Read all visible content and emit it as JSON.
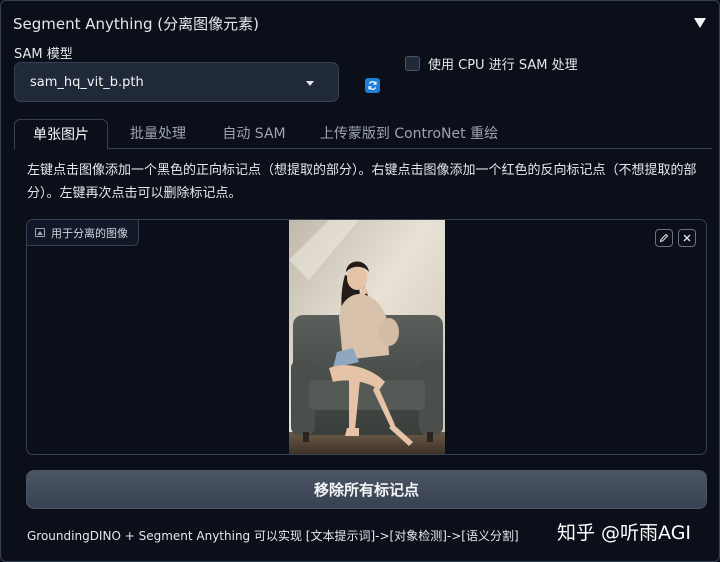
{
  "panel": {
    "title": "Segment Anything (分离图像元素)"
  },
  "model": {
    "label": "SAM 模型",
    "selected": "sam_hq_vit_b.pth"
  },
  "cpu_option": {
    "label": "使用 CPU 进行 SAM 处理",
    "checked": false
  },
  "tabs": [
    {
      "label": "单张图片",
      "active": true
    },
    {
      "label": "批量处理",
      "active": false
    },
    {
      "label": "自动 SAM",
      "active": false
    },
    {
      "label": "上传蒙版到 ControNet 重绘",
      "active": false
    }
  ],
  "instructions": "左键点击图像添加一个黑色的正向标记点（想提取的部分）。右键点击图像添加一个红色的反向标记点（不想提取的部分）。左键再次点击可以删除标记点。",
  "image_input": {
    "label": "用于分离的图像"
  },
  "remove_button": "移除所有标记点",
  "footer": "GroundingDINO + Segment Anything 可以实现 [文本提示词]->[对象检测]->[语义分割]",
  "watermark": "知乎 @听雨AGI",
  "colors": {
    "background": "#0b0f19",
    "accent": "#1d7fd8",
    "button": "#4b5563"
  }
}
